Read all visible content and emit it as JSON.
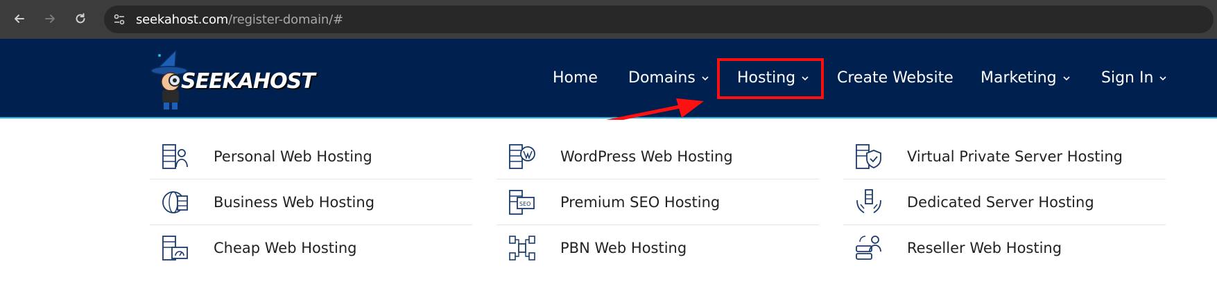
{
  "browser": {
    "url_host": "seekahost.com",
    "url_path": "/register-domain/#"
  },
  "header": {
    "logo_text": "SEEKAHOST",
    "menu": {
      "home": "Home",
      "domains": "Domains",
      "hosting": "Hosting",
      "create_website": "Create Website",
      "marketing": "Marketing",
      "sign_in": "Sign In"
    }
  },
  "dropdown": {
    "col1": [
      "Personal Web Hosting",
      "Business Web Hosting",
      "Cheap Web Hosting"
    ],
    "col2": [
      "WordPress Web Hosting",
      "Premium SEO Hosting",
      "PBN Web Hosting"
    ],
    "col3": [
      "Virtual Private Server Hosting",
      "Dedicated Server Hosting",
      "Reseller Web Hosting"
    ],
    "icons": {
      "col1": [
        "server-person-icon",
        "globe-server-icon",
        "server-gauge-icon"
      ],
      "col2": [
        "wordpress-server-icon",
        "seo-server-icon",
        "network-nodes-icon"
      ],
      "col3": [
        "server-shield-icon",
        "hands-server-icon",
        "server-user-icon"
      ]
    }
  },
  "colors": {
    "header_bg": "#00204f",
    "accent_line": "#21b7e6",
    "highlight": "#ff1010",
    "icon_stroke": "#1a3a6b"
  }
}
